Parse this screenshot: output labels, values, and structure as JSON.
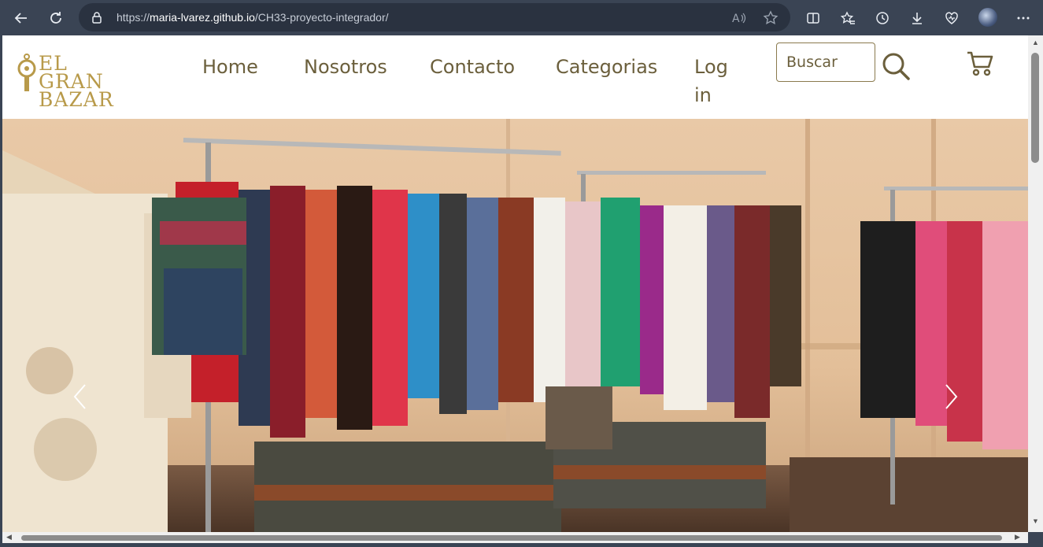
{
  "browser": {
    "url_domain": "maria-lvarez.github.io",
    "url_path": "/CH33-proyecto-integrador/",
    "url_scheme": "https://"
  },
  "site": {
    "logo_line1": "EL",
    "logo_line2": "GRAN BAZAR",
    "nav": [
      "Home",
      "Nosotros",
      "Contacto",
      "Categorias",
      "Log in"
    ],
    "search_placeholder": "Buscar"
  },
  "colors": {
    "chrome": "#3a4454",
    "accent_gold": "#b89a4a",
    "nav_text": "#6b5f3c"
  },
  "icons": {
    "back": "back-arrow-icon",
    "refresh": "refresh-icon",
    "lock": "lock-icon",
    "read_aloud": "read-aloud-icon",
    "favorite": "star-icon",
    "split": "split-screen-icon",
    "favorites": "favorites-icon",
    "history": "history-icon",
    "downloads": "download-icon",
    "health": "browser-essentials-icon",
    "menu": "more-icon",
    "search": "search-icon",
    "cart": "cart-icon",
    "prev": "chevron-left-icon",
    "next": "chevron-right-icon"
  }
}
